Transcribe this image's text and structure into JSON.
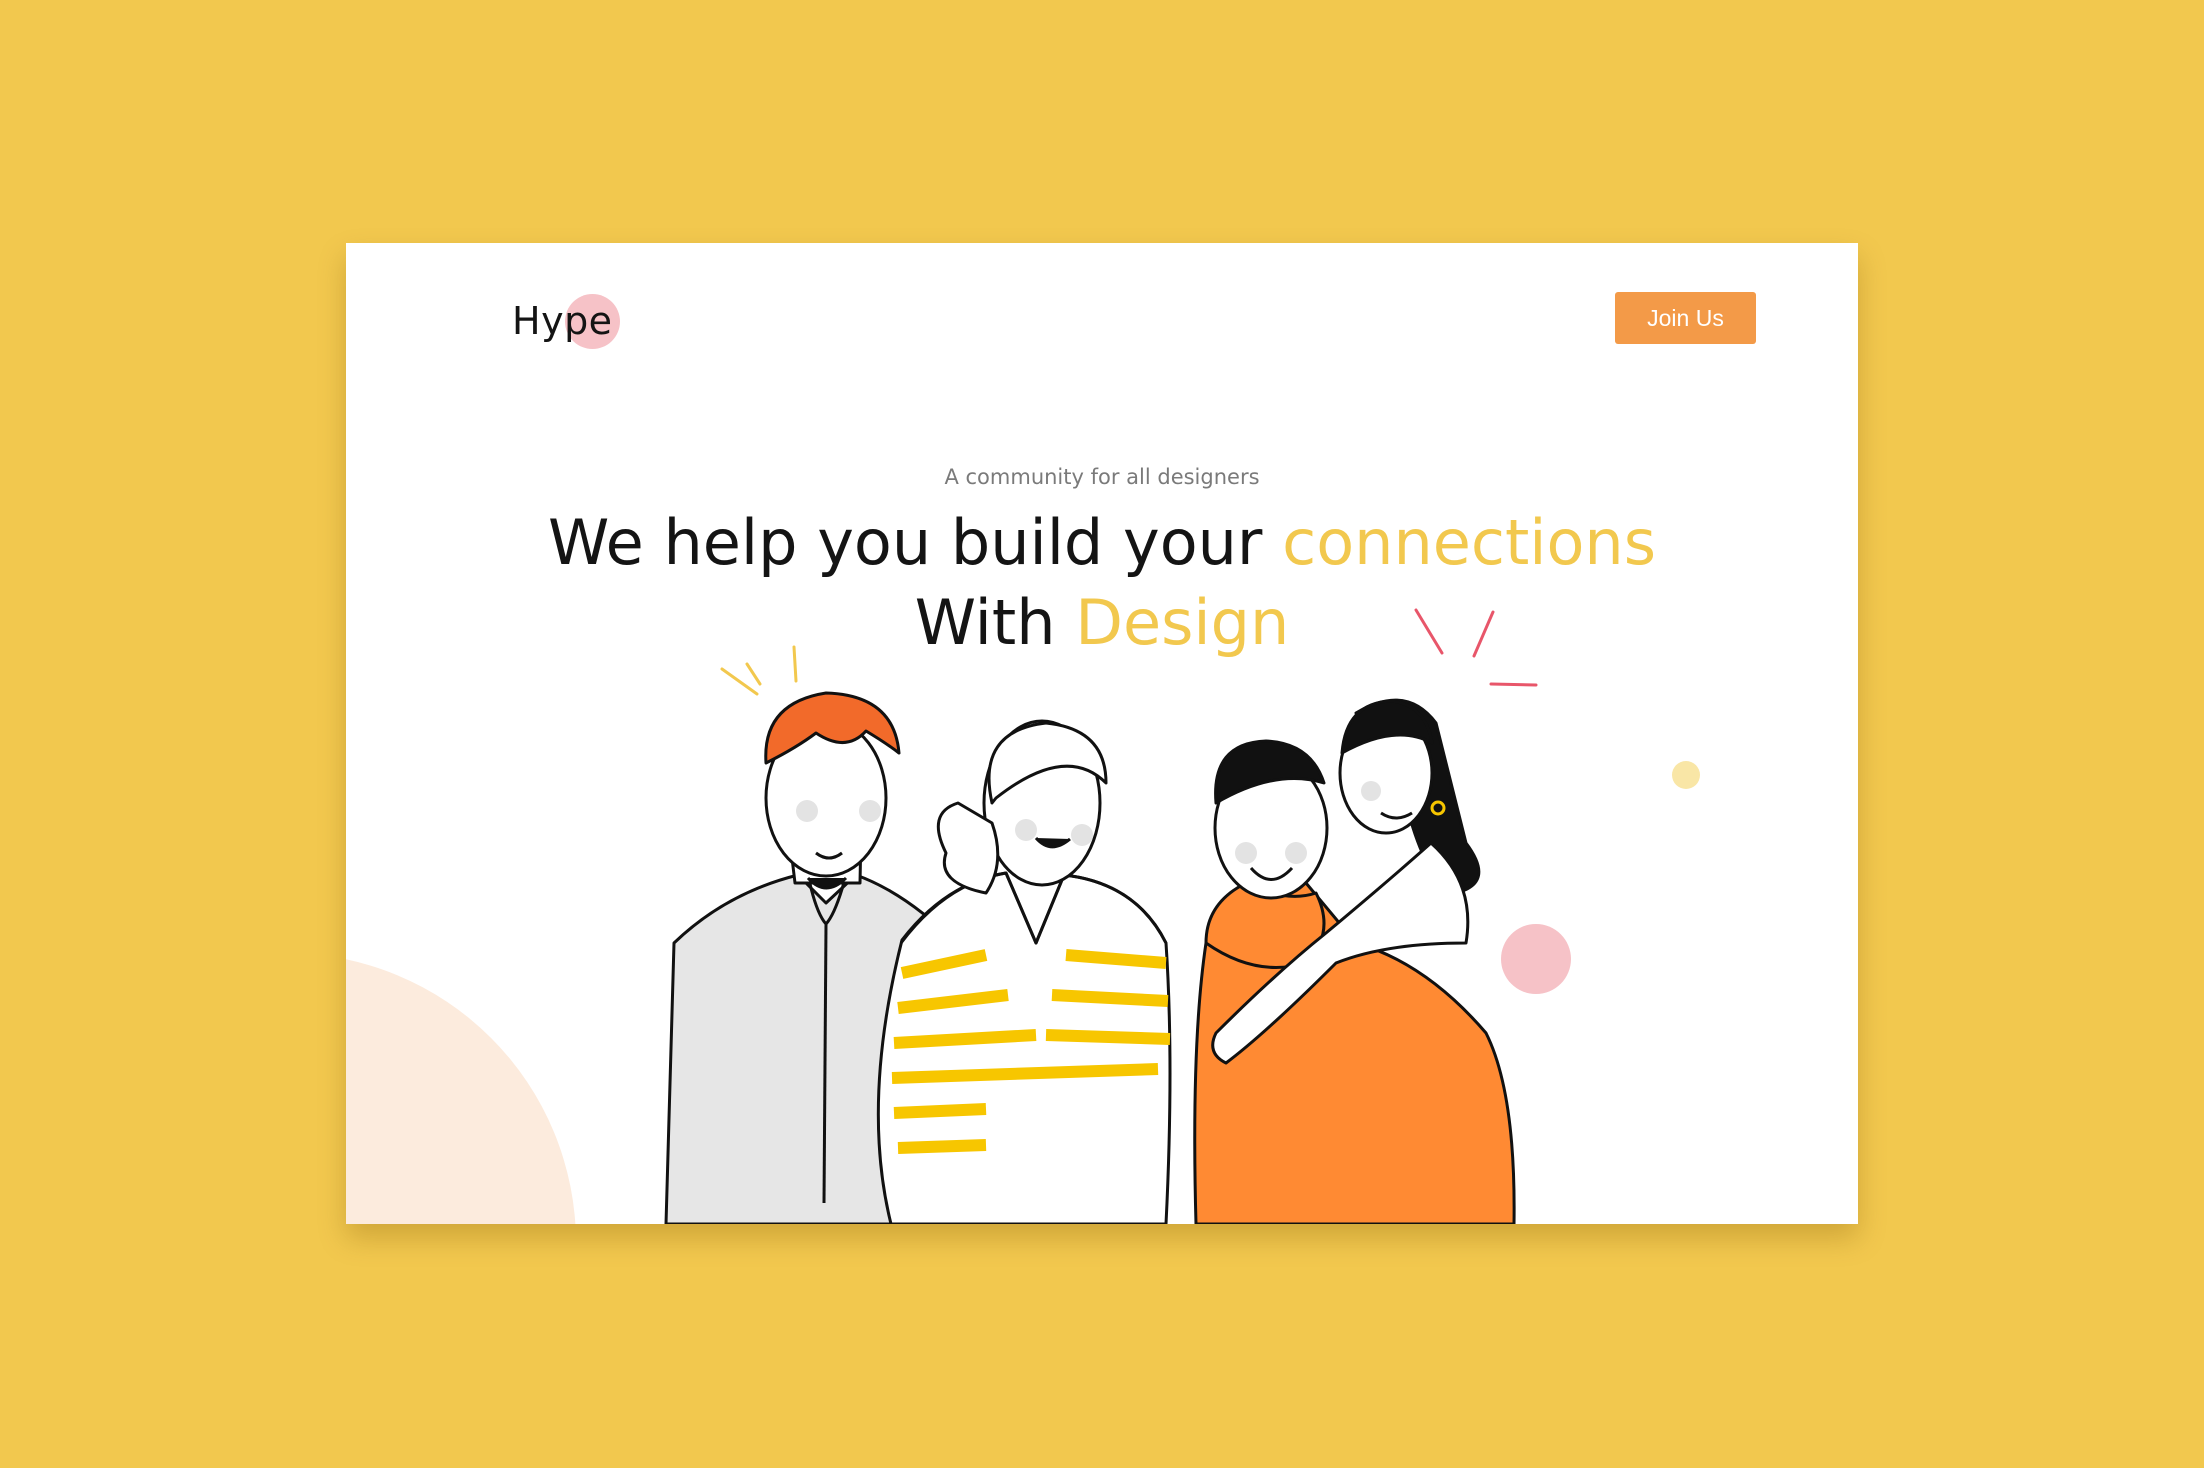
{
  "brand": {
    "name": "Hype"
  },
  "nav": {
    "join_label": "Join Us"
  },
  "hero": {
    "tagline": "A community for all designers",
    "headline_part1": "We help you build your ",
    "headline_accent1": "connections",
    "headline_part2": "With ",
    "headline_accent2": "Design"
  },
  "colors": {
    "page_background": "#F2C84E",
    "accent_yellow": "#F2C84E",
    "button_orange": "#F39A48",
    "logo_pink": "#F6C2C7",
    "shirt_orange": "#FF8A33",
    "hair_orange": "#F26A2A",
    "stripe_yellow": "#F7C600",
    "peach_circle": "#FCEBDD"
  },
  "illustration": {
    "subject": "group-of-four-friends",
    "icons": [
      "peach-circle-decoration",
      "pink-dot-decoration",
      "yellow-dot-decoration",
      "sparkle-lines"
    ]
  }
}
